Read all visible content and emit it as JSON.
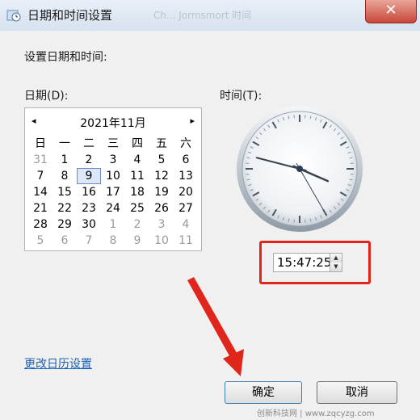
{
  "window": {
    "title": "日期和时间设置",
    "ghost_text": "Ch... Jormsmort 时间",
    "close_label": "✕"
  },
  "heading": "设置日期和时间:",
  "date_label": "日期(D):",
  "time_label": "时间(T):",
  "calendar": {
    "prev": "◂",
    "next": "▸",
    "month_label": "2021年11月",
    "weekdays": [
      "日",
      "一",
      "二",
      "三",
      "四",
      "五",
      "六"
    ],
    "days": [
      [
        "31",
        "1",
        "2",
        "3",
        "4",
        "5",
        "6"
      ],
      [
        "7",
        "8",
        "9",
        "10",
        "11",
        "12",
        "13"
      ],
      [
        "14",
        "15",
        "16",
        "17",
        "18",
        "19",
        "20"
      ],
      [
        "21",
        "22",
        "23",
        "24",
        "25",
        "26",
        "27"
      ],
      [
        "28",
        "29",
        "30",
        "1",
        "2",
        "3",
        "4"
      ],
      [
        "5",
        "6",
        "7",
        "8",
        "9",
        "10",
        "11"
      ]
    ],
    "selected_day": "9"
  },
  "clock": {
    "hour": 15,
    "minute": 47,
    "second": 25
  },
  "time_value": "15:47:25",
  "spin_up": "▲",
  "spin_down": "▼",
  "change_calendar_link": "更改日历设置",
  "buttons": {
    "ok": "确定",
    "cancel": "取消"
  },
  "watermark": "创新科技网 | www.zqcyzg.com",
  "colors": {
    "highlight": "#e0261c",
    "link": "#1e5fb4",
    "close": "#c9463a"
  }
}
